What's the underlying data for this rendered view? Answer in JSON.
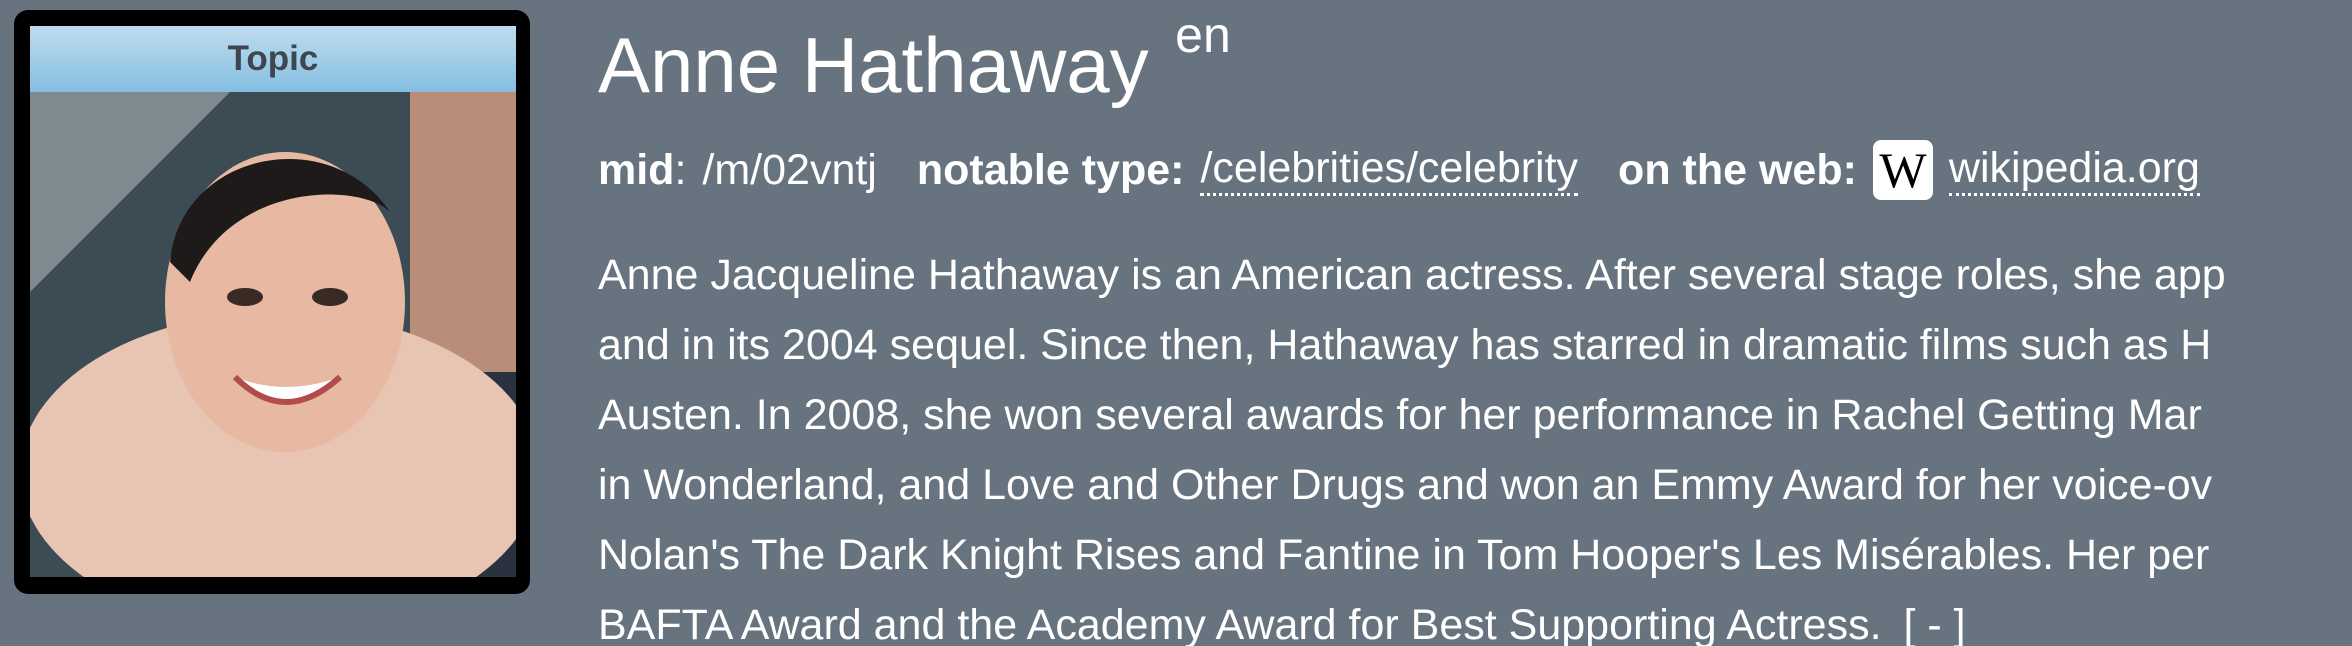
{
  "card": {
    "label": "Topic",
    "image_alt": "Anne Hathaway photo"
  },
  "topic": {
    "title": "Anne Hathaway",
    "lang": "en"
  },
  "meta": {
    "mid_label": "mid",
    "mid_value": "/m/02vntj",
    "notable_type_label": "notable type:",
    "notable_type_value": "/celebrities/celebrity",
    "web_label": "on the web:",
    "web_icon": "wikipedia-icon",
    "web_link": "wikipedia.org"
  },
  "description": {
    "lines": [
      "Anne Jacqueline Hathaway is an American actress. After several stage roles, she app",
      "and in its 2004 sequel. Since then, Hathaway has starred in dramatic films such as H",
      "Austen. In 2008, she won several awards for her performance in Rachel Getting Mar",
      "in Wonderland, and Love and Other Drugs and won an Emmy Award for her voice-ov",
      "Nolan's The Dark Knight Rises and Fantine in Tom Hooper's Les Misérables. Her per",
      "BAFTA Award and the Academy Award for Best Supporting Actress."
    ],
    "collapse_label": "[ - ]"
  }
}
